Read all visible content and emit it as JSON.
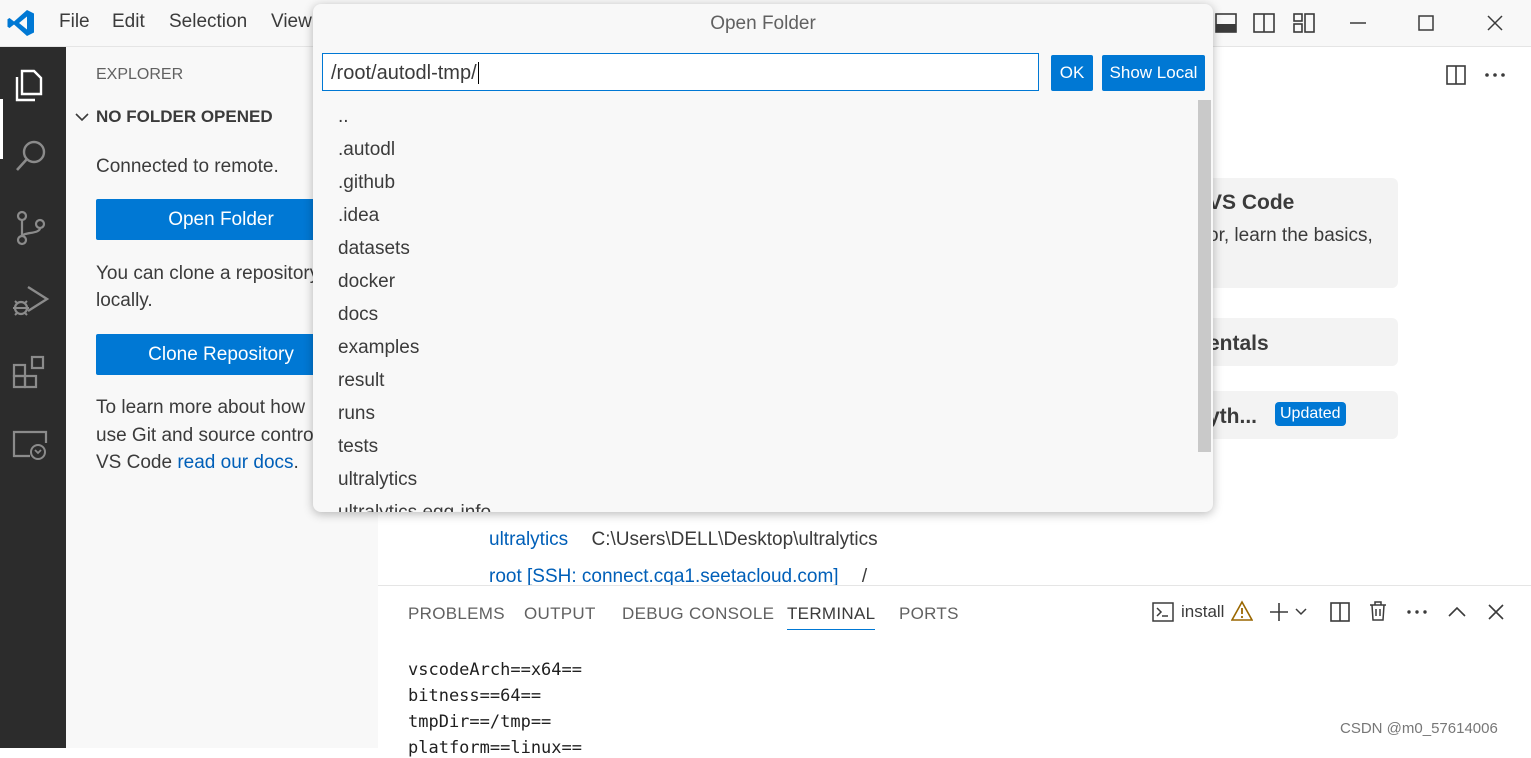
{
  "menu": [
    "File",
    "Edit",
    "Selection",
    "View"
  ],
  "sidebar": {
    "title": "EXPLORER",
    "section": "NO FOLDER OPENED",
    "connected": "Connected to remote.",
    "open_folder": "Open Folder",
    "clone_text_1": "You can clone a repository",
    "clone_text_2": "locally.",
    "clone_repo": "Clone Repository",
    "learn_1": "To learn more about how",
    "learn_2": "use Git and source control",
    "learn_3_prefix": "VS Code ",
    "learn_3_link": "read our docs",
    "learn_3_suffix": "."
  },
  "editor": {
    "card1_title": "VS Code",
    "card1_text": "or, learn the basics,",
    "card2_title": "entals",
    "card3_title": "yth...",
    "card3_badge": "Updated",
    "recent": [
      {
        "name": "ultralytics",
        "path": "C:\\Users\\DELL\\Desktop\\ultralytics"
      },
      {
        "name": "root [SSH: connect.cqa1.seetacloud.com]",
        "path": "/"
      }
    ]
  },
  "panel": {
    "tabs": [
      "PROBLEMS",
      "OUTPUT",
      "DEBUG CONSOLE",
      "TERMINAL",
      "PORTS"
    ],
    "active_tab": "TERMINAL",
    "terminal_name": "install",
    "terminal_lines": [
      "vscodeArch==x64==",
      "bitness==64==",
      "tmpDir==/tmp==",
      "platform==linux=="
    ]
  },
  "quickpick": {
    "title": "Open Folder",
    "input_value": "/root/autodl-tmp/",
    "ok_label": "OK",
    "show_local_label": "Show Local",
    "items": [
      "..",
      ".autodl",
      ".github",
      ".idea",
      "datasets",
      "docker",
      "docs",
      "examples",
      "result",
      "runs",
      "tests",
      "ultralytics",
      "ultralytics.egg-info"
    ]
  },
  "watermark": "CSDN @m0_57614006",
  "colors": {
    "accent": "#0078d4",
    "activitybar": "#2c2c2c",
    "link": "#005fb8"
  }
}
